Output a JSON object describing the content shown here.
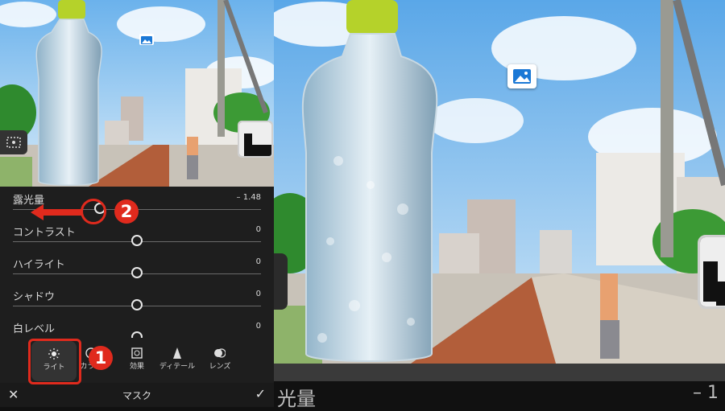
{
  "panel": {
    "sliders": [
      {
        "label": "露光量",
        "value": "– 1.48",
        "level": -1.48
      },
      {
        "label": "コントラスト",
        "value": "0",
        "level": 0
      },
      {
        "label": "ハイライト",
        "value": "0",
        "level": 0
      },
      {
        "label": "シャドウ",
        "value": "0",
        "level": 0
      },
      {
        "label": "白レベル",
        "value": "0",
        "level": 0
      }
    ],
    "tabs": [
      {
        "label": "ライト",
        "icon": "sun-icon",
        "selected": true
      },
      {
        "label": "カラー",
        "icon": "color-icon"
      },
      {
        "label": "効果",
        "icon": "effects-icon"
      },
      {
        "label": "ディテール",
        "icon": "detail-icon"
      },
      {
        "label": "レンズ",
        "icon": "lens-icon"
      }
    ],
    "bottom": {
      "close_icon": "✕",
      "title": "マスク",
      "confirm_icon": "✓"
    }
  },
  "zoom_bar": {
    "label": "光量",
    "value": "– 1"
  },
  "annotations": {
    "step1": "1",
    "step2": "2",
    "color": "#e02a1d"
  },
  "colors": {
    "panel_bg": "#1e1e1e",
    "sky": "#8fc4ee",
    "bottle_cap": "#b5d22a"
  }
}
